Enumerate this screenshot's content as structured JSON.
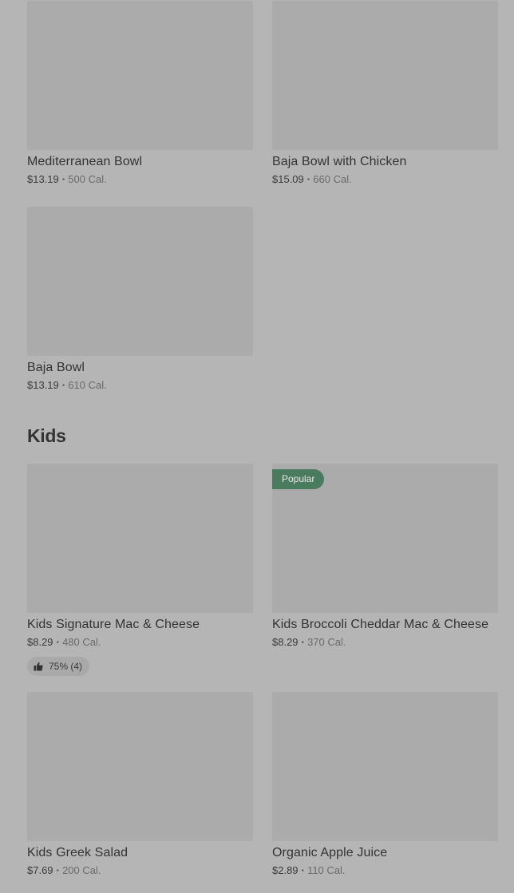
{
  "items_top": [
    {
      "name": "Mediterranean Bowl",
      "price": "$13.19",
      "cal": "500 Cal."
    },
    {
      "name": "Baja Bowl with Chicken",
      "price": "$15.09",
      "cal": "660 Cal."
    },
    {
      "name": "Baja Bowl",
      "price": "$13.19",
      "cal": "610 Cal."
    }
  ],
  "kids_section": {
    "title": "Kids",
    "items": [
      {
        "name": "Kids Signature Mac & Cheese",
        "price": "$8.29",
        "cal": "480 Cal.",
        "rating": "75% (4)"
      },
      {
        "name": "Kids Broccoli Cheddar Mac & Cheese",
        "price": "$8.29",
        "cal": "370 Cal.",
        "badge": "Popular"
      },
      {
        "name": "Kids Greek Salad",
        "price": "$7.69",
        "cal": "200 Cal."
      },
      {
        "name": "Organic Apple Juice",
        "price": "$2.89",
        "cal": "110 Cal."
      }
    ]
  },
  "separator": "•",
  "icons": {
    "rating": "thumbs-up-icon"
  },
  "colors": {
    "badge_bg": "#4a7b5f",
    "background": "#b5b5b5",
    "thumb": "#ababab"
  }
}
